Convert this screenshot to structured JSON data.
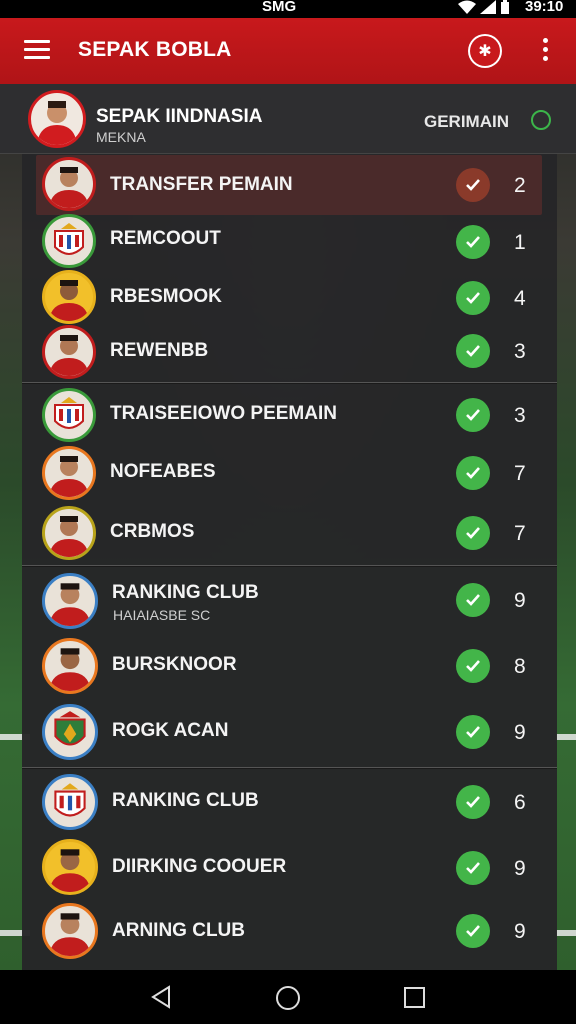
{
  "status_bar": {
    "carrier": "SMG",
    "time": "39:10"
  },
  "app_bar": {
    "title": "SEPAK BOBLA"
  },
  "header": {
    "title": "SEPAK IINDNASIA",
    "subtitle": "MEKNA",
    "action": "GERIMAIN"
  },
  "rows": [
    {
      "label": "TRANSFER PEMAIN",
      "count": "2",
      "avatar": "player-icon"
    },
    {
      "label": "REMCOOUT",
      "count": "1",
      "avatar": "club-crest-icon"
    },
    {
      "label": "RBESMOOK",
      "count": "4",
      "avatar": "player-icon"
    },
    {
      "label": "REWENBB",
      "count": "3",
      "avatar": "player-icon"
    },
    {
      "label": "TRAISEEIOWO PEEMAIN",
      "count": "3",
      "avatar": "club-crest-icon"
    },
    {
      "label": "NOFEABES",
      "count": "7",
      "avatar": "player-icon"
    },
    {
      "label": "CRBMOS",
      "count": "7",
      "avatar": "player-icon"
    },
    {
      "label": "RANKING CLUB",
      "sublabel": "HAIAIASBE SC",
      "count": "9",
      "avatar": "player-icon"
    },
    {
      "label": "BURSKNOOR",
      "count": "8",
      "avatar": "player-icon"
    },
    {
      "label": "ROGK ACAN",
      "count": "9",
      "avatar": "club-crest-icon"
    },
    {
      "label": "RANKING CLUB",
      "count": "6",
      "avatar": "club-crest-icon"
    },
    {
      "label": "DIIRKING COOUER",
      "count": "9",
      "avatar": "player-icon"
    },
    {
      "label": "ARNING CLUB",
      "count": "9",
      "avatar": "player-icon"
    }
  ],
  "colors": {
    "brand_red": "#c8191c",
    "check_green": "#43b549",
    "panel": "#262628"
  }
}
